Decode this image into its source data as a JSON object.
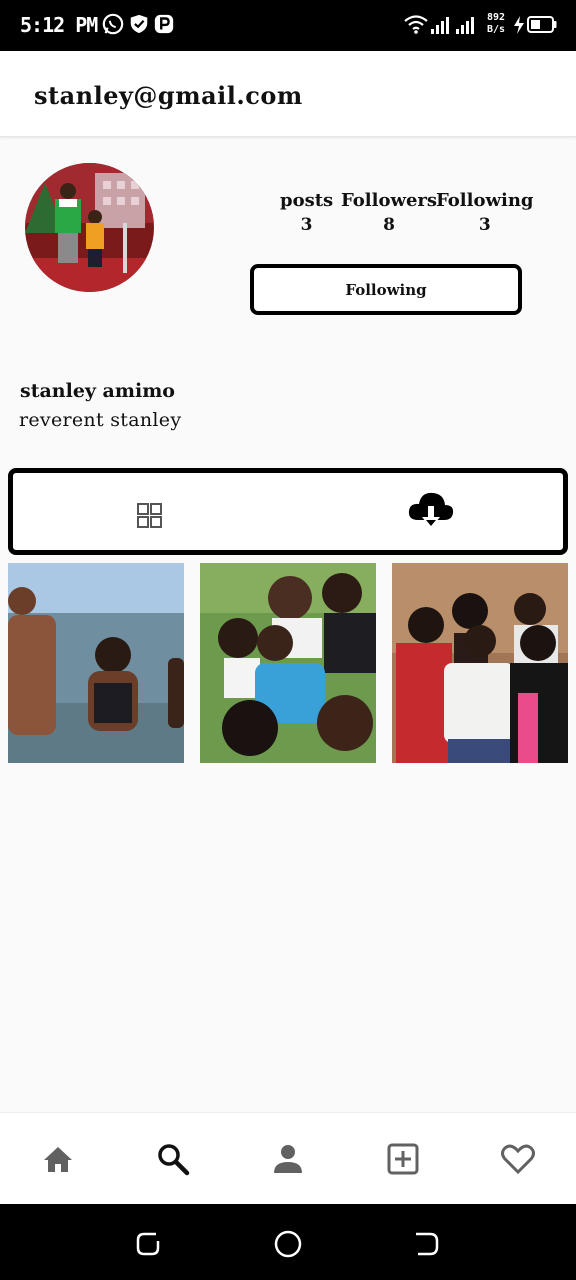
{
  "status_bar": {
    "time": "5:12 PM",
    "speed_top": "892",
    "speed_bottom": "B/s",
    "icons": [
      "whatsapp-icon",
      "shield-icon",
      "p-icon",
      "wifi-icon",
      "signal-icon",
      "signal-icon",
      "bolt-icon",
      "battery-icon"
    ]
  },
  "header": {
    "title": "stanley@gmail.com"
  },
  "profile": {
    "stats": [
      {
        "label": "posts",
        "value": "3"
      },
      {
        "label": "Followers",
        "value": "8"
      },
      {
        "label": "Following",
        "value": "3"
      }
    ],
    "follow_button": "Following",
    "name": "stanley amimo",
    "bio": "reverent stanley"
  },
  "tabs": {
    "icons": [
      "grid-icon",
      "cloud-download-icon"
    ]
  },
  "posts": [
    {
      "description": "beach swim photo"
    },
    {
      "description": "group selfie outdoors"
    },
    {
      "description": "family indoor photo"
    }
  ],
  "bottom_nav": {
    "icons": [
      "home-icon",
      "search-icon",
      "person-icon",
      "add-box-icon",
      "heart-icon"
    ]
  },
  "system_nav": {
    "icons": [
      "recent-apps-icon",
      "home-circle-icon",
      "back-icon"
    ]
  },
  "colors": {
    "status_bar": "#000000",
    "header_bg": "#ffffff",
    "page_bg": "#fafafa",
    "icon_gray": "#616161"
  }
}
